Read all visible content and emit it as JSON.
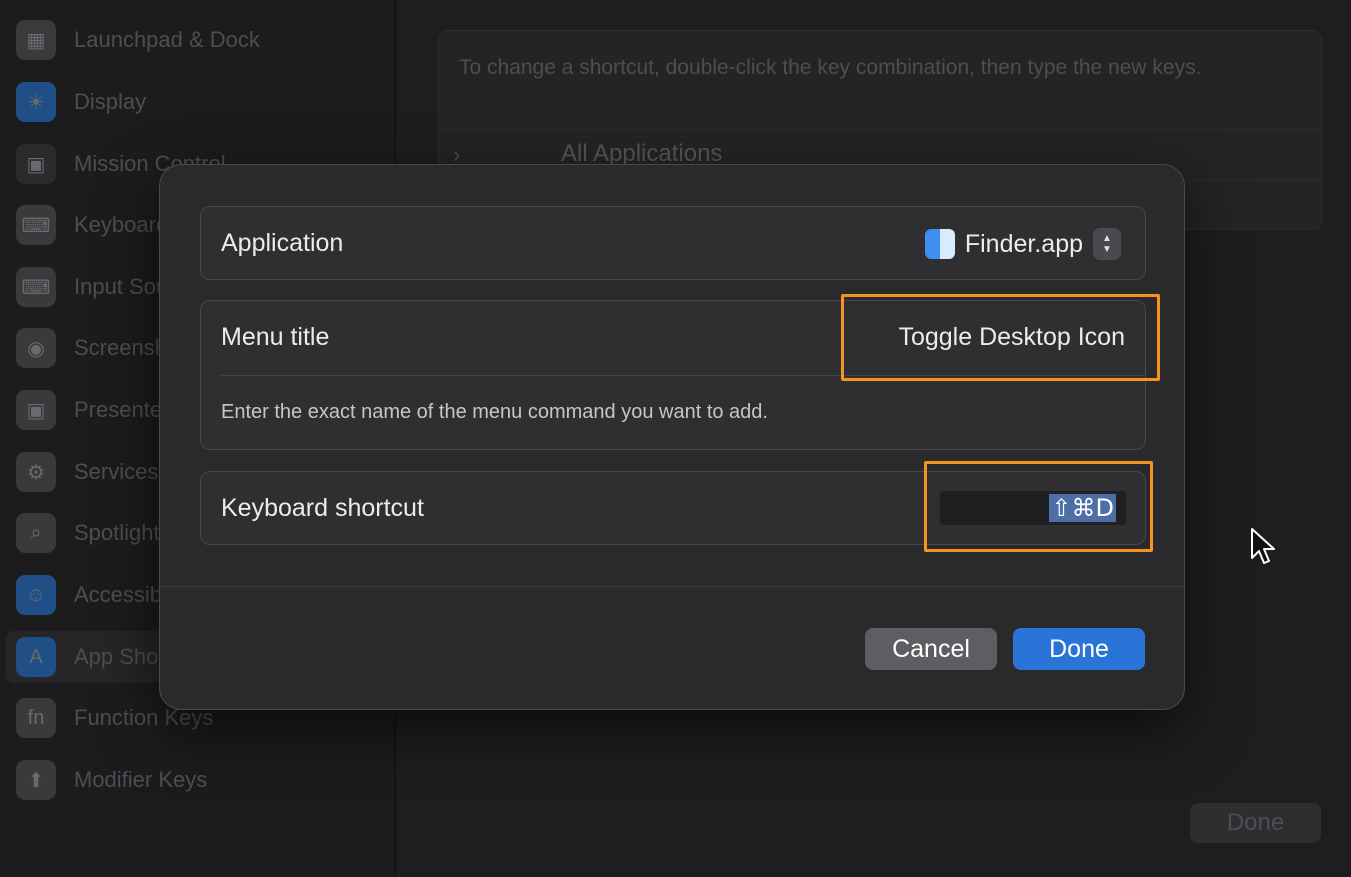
{
  "sidebar": {
    "items": [
      {
        "label": "Launchpad & Dock",
        "icon": "launchpad-icon",
        "glyph": "▦",
        "color": "#3b3b3e"
      },
      {
        "label": "Display",
        "icon": "display-icon",
        "glyph": "☀",
        "color": "#1f4f86"
      },
      {
        "label": "Mission Control",
        "icon": "mission-control-icon",
        "glyph": "▣",
        "color": "#2b2b2e"
      },
      {
        "label": "Keyboard",
        "icon": "keyboard-icon",
        "glyph": "⌨",
        "color": "#3a3a3d"
      },
      {
        "label": "Input Sources",
        "icon": "input-sources-icon",
        "glyph": "⌨",
        "color": "#3a3a3d"
      },
      {
        "label": "Screenshots",
        "icon": "screenshot-icon",
        "glyph": "◉",
        "color": "#3a3a3d"
      },
      {
        "label": "Presenter Overlay",
        "icon": "presenter-icon",
        "glyph": "▣",
        "color": "#3a3a3d"
      },
      {
        "label": "Services",
        "icon": "services-gear-icon",
        "glyph": "⚙",
        "color": "#3a3a3d"
      },
      {
        "label": "Spotlight",
        "icon": "spotlight-search-icon",
        "glyph": "⌕",
        "color": "#3a3a3d"
      },
      {
        "label": "Accessibility",
        "icon": "accessibility-icon",
        "glyph": "☺",
        "color": "#1f4f86"
      },
      {
        "label": "App Shortcuts",
        "icon": "app-store-icon",
        "glyph": "A",
        "color": "#1f4f86",
        "selected": true
      },
      {
        "label": "Function Keys",
        "icon": "fn-key-icon",
        "glyph": "fn",
        "color": "#3a3a3d"
      },
      {
        "label": "Modifier Keys",
        "icon": "modifier-up-arrow-icon",
        "glyph": "⬆",
        "color": "#3a3a3d"
      }
    ]
  },
  "main": {
    "info_text": "To change a shortcut, double-click the key combination, then type the new keys.",
    "all_apps_label": "All Applications",
    "done_label": "Done"
  },
  "sheet": {
    "application_label": "Application",
    "application_value": "Finder.app",
    "menu_title_label": "Menu title",
    "menu_title_value": "Toggle Desktop Icon",
    "menu_hint": "Enter the exact name of the menu command you want to add.",
    "keyboard_shortcut_label": "Keyboard shortcut",
    "keyboard_shortcut_value": "⇧⌘D",
    "cancel_label": "Cancel",
    "done_label": "Done"
  },
  "colors": {
    "accent": "#2a74d8",
    "highlight": "#f5931f"
  }
}
